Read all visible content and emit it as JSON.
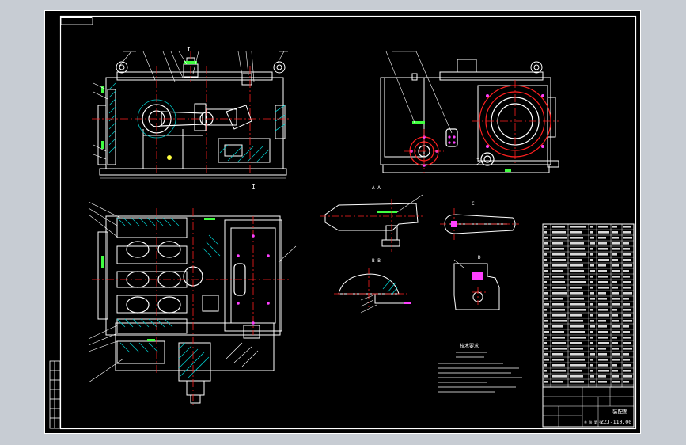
{
  "colors": {
    "background": "#000000",
    "canvas_outer": "#c7ccd3",
    "line_main": "#ffffff",
    "centerline": "#ff2020",
    "hatch": "#00c8c8",
    "accent_green": "#40ff40",
    "accent_magenta": "#ff40ff",
    "accent_yellow": "#ffff40"
  },
  "title_block": {
    "drawing_code": "ZZJ-110.00",
    "name_label": "装配图",
    "sheet_label": "共 张 第 张"
  },
  "section_marks": {
    "front_view_mark": "I",
    "plan_view_mark": "I",
    "section_a": "A-A",
    "section_b": "B-B",
    "detail_c": "C",
    "detail_d": "D"
  },
  "notes_title": "技术要求"
}
